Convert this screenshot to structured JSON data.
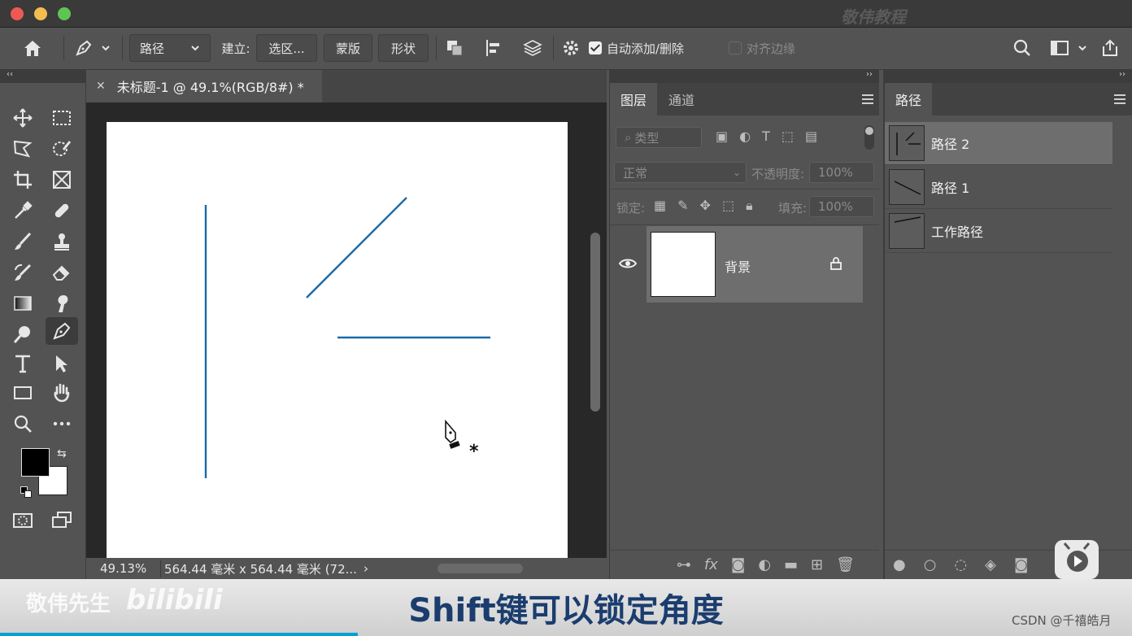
{
  "window": {
    "watermark": "敬伟教程"
  },
  "options_bar": {
    "path_mode": "路径",
    "make_label": "建立:",
    "selection_button": "选区...",
    "mask_button": "蒙版",
    "shape_button": "形状",
    "auto_add_delete": "自动添加/删除",
    "align_edges": "对齐边缘"
  },
  "document": {
    "tab_title": "未标题-1 @ 49.1%(RGB/8#) *",
    "zoom": "49.13%",
    "size_info": "564.44 毫米 x 564.44 毫米 (72..."
  },
  "layers_panel": {
    "tabs": [
      "图层",
      "通道"
    ],
    "filter_placeholder": "类型",
    "blend_mode": "正常",
    "opacity_label": "不透明度:",
    "opacity_value": "100%",
    "lock_label": "锁定:",
    "fill_label": "填充:",
    "fill_value": "100%",
    "layers": [
      {
        "name": "背景",
        "visible": true,
        "locked": true
      }
    ]
  },
  "paths_panel": {
    "tab": "路径",
    "paths": [
      {
        "name": "路径 2",
        "selected": true
      },
      {
        "name": "路径 1",
        "selected": false
      },
      {
        "name": "工作路径",
        "selected": false
      }
    ]
  },
  "video": {
    "caption": "Shift键可以锁定角度",
    "channel": "敬伟先生",
    "platform_logo": "bilibili",
    "credit": "CSDN @千禧皓月"
  },
  "colors": {
    "path_stroke": "#1a6aa8",
    "caption_text": "#1b3d6e",
    "progress": "#00a1d6"
  }
}
